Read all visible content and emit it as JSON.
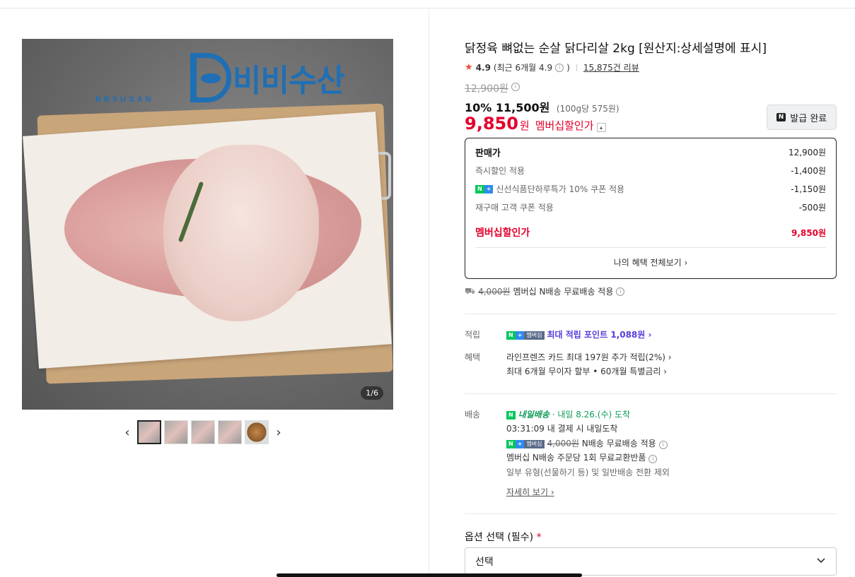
{
  "gallery": {
    "logo_text": "비비수산",
    "logo_sub": "BBSUSAN",
    "counter": "1/6",
    "prev_glyph": "‹",
    "next_glyph": "›"
  },
  "product": {
    "title": "닭정육 뼈없는 순살 닭다리살 2kg [원산지:상세설명에 표시]",
    "rating": "4.9",
    "rating_recent": "(최근 6개월 4.9",
    "rating_close": ")",
    "reviews": "15,875건 리뷰",
    "original_price": "12,900원",
    "discount_pct": "10%",
    "sale_price": "11,500원",
    "unit_price": "(100g당 575원)",
    "member_price": "9,850",
    "member_won": "원",
    "member_label": "멤버십할인가",
    "coupon_button": "발급 완료",
    "coupon_badge": "N"
  },
  "breakdown": {
    "rows": [
      {
        "label": "판매가",
        "value": "12,900원"
      },
      {
        "label": "즉시할인 적용",
        "value": "-1,400원"
      },
      {
        "label": "신선식품단하루특가 10% 쿠폰 적용",
        "value": "-1,150원"
      },
      {
        "label": "재구매 고객 쿠폰 적용",
        "value": "-500원"
      }
    ],
    "member_label": "멤버십할인가",
    "member_value": "9,850원",
    "link": "나의 혜택 전체보기 ›"
  },
  "shipping_summary": {
    "strike": "4,000원",
    "text": "멤버십 N배송 무료배송 적용"
  },
  "points": {
    "label": "적립",
    "text": "최대 적립 포인트 1,088원 ›"
  },
  "benefits": {
    "label": "혜택",
    "line1": "라인프렌즈 카드 최대 197원 추가 적립(2%) ›",
    "line2": "최대 6개월 무이자 할부 • 60개월 특별금리 ›"
  },
  "delivery": {
    "label": "배송",
    "badge": "내일배송",
    "eta": "· 내일 8.26.(수) 도착",
    "deadline": "03:31:09  내 결제 시 내일도착",
    "free_strike": "4,000원",
    "free_text": "N배송 무료배송 적용",
    "exchange": "멤버십 N배송 주문당 1회 무료교환반품",
    "exclude": "일부 유형(선물하기 등) 및 일반배송 전환 제외",
    "detail_link": "자세히 보기 ›"
  },
  "option": {
    "label": "옵션 선택 (필수)",
    "required_mark": "*",
    "select_value": "선택"
  },
  "colors": {
    "accent_red": "#e4002b",
    "naver_green": "#03c75a",
    "point_purple": "#5a3cdc"
  }
}
